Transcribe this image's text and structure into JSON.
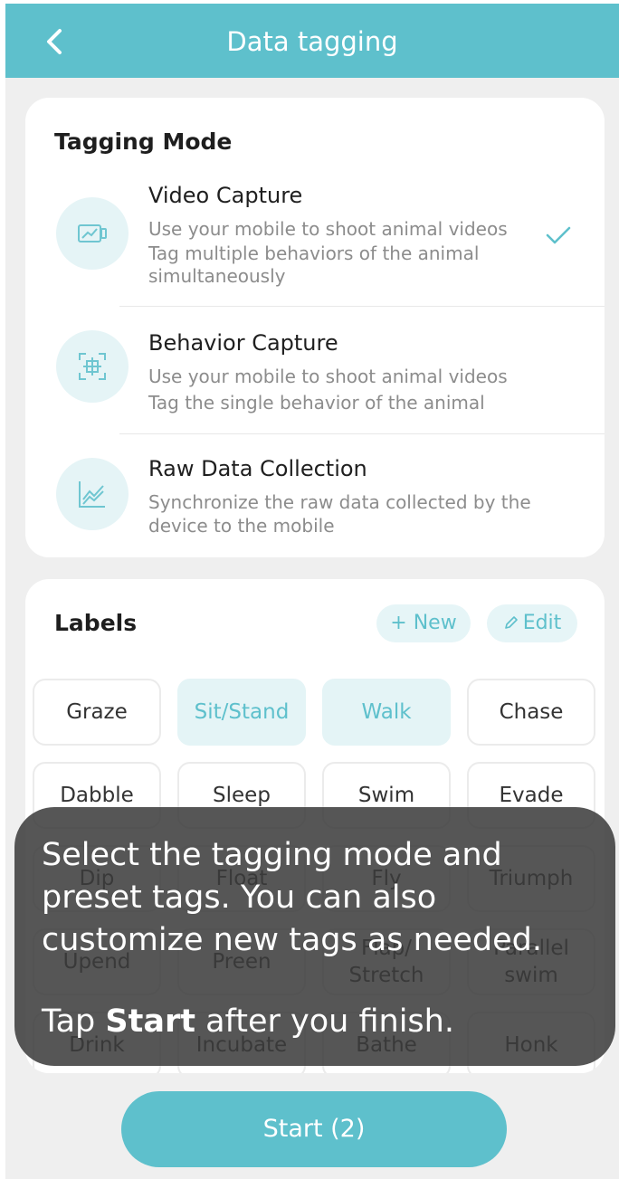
{
  "header": {
    "title": "Data tagging"
  },
  "tagging_mode": {
    "title": "Tagging Mode",
    "modes": [
      {
        "name": "Video Capture",
        "desc": [
          "Use your mobile to shoot animal videos",
          "Tag multiple behaviors of the animal",
          "simultaneously"
        ],
        "selected": true,
        "icon": "video-icon"
      },
      {
        "name": "Behavior Capture",
        "desc": [
          "Use your mobile to shoot animal videos",
          "Tag the single behavior of the animal"
        ],
        "selected": false,
        "icon": "focus-frame-icon"
      },
      {
        "name": "Raw Data Collection",
        "desc": [
          "Synchronize the raw data collected by the",
          "device to the mobile"
        ],
        "selected": false,
        "icon": "line-chart-icon"
      }
    ]
  },
  "labels": {
    "title": "Labels",
    "new_button": "+ New",
    "edit_button": "Edit",
    "chips": [
      {
        "label": "Graze",
        "selected": false
      },
      {
        "label": "Sit/Stand",
        "selected": true
      },
      {
        "label": "Walk",
        "selected": true
      },
      {
        "label": "Chase",
        "selected": false
      },
      {
        "label": "Dabble",
        "selected": false
      },
      {
        "label": "Sleep",
        "selected": false
      },
      {
        "label": "Swim",
        "selected": false
      },
      {
        "label": "Evade",
        "selected": false
      },
      {
        "label": "Dip",
        "selected": false
      },
      {
        "label": "Float",
        "selected": false
      },
      {
        "label": "Fly",
        "selected": false
      },
      {
        "label": "Triumph",
        "selected": false
      },
      {
        "label": "Upend",
        "selected": false
      },
      {
        "label": "Preen",
        "selected": false
      },
      {
        "label": "Flap/\nStretch",
        "selected": false
      },
      {
        "label": "Parallel\nswim",
        "selected": false
      },
      {
        "label": "Drink",
        "selected": false
      },
      {
        "label": "Incubate",
        "selected": false
      },
      {
        "label": "Bathe",
        "selected": false
      },
      {
        "label": "Honk",
        "selected": false
      }
    ]
  },
  "start_button": "Start (2)",
  "overlay": {
    "line1": "Select the tagging mode and",
    "line2": "preset tags. You can also",
    "line3": "customize new tags as needed.",
    "tap_prefix": "Tap",
    "tap_bold": "Start",
    "tap_suffix": "after you finish."
  },
  "colors": {
    "accent": "#5ec0cc",
    "accent_light": "#e4f4f6",
    "overlay": "#3a3a3a"
  }
}
